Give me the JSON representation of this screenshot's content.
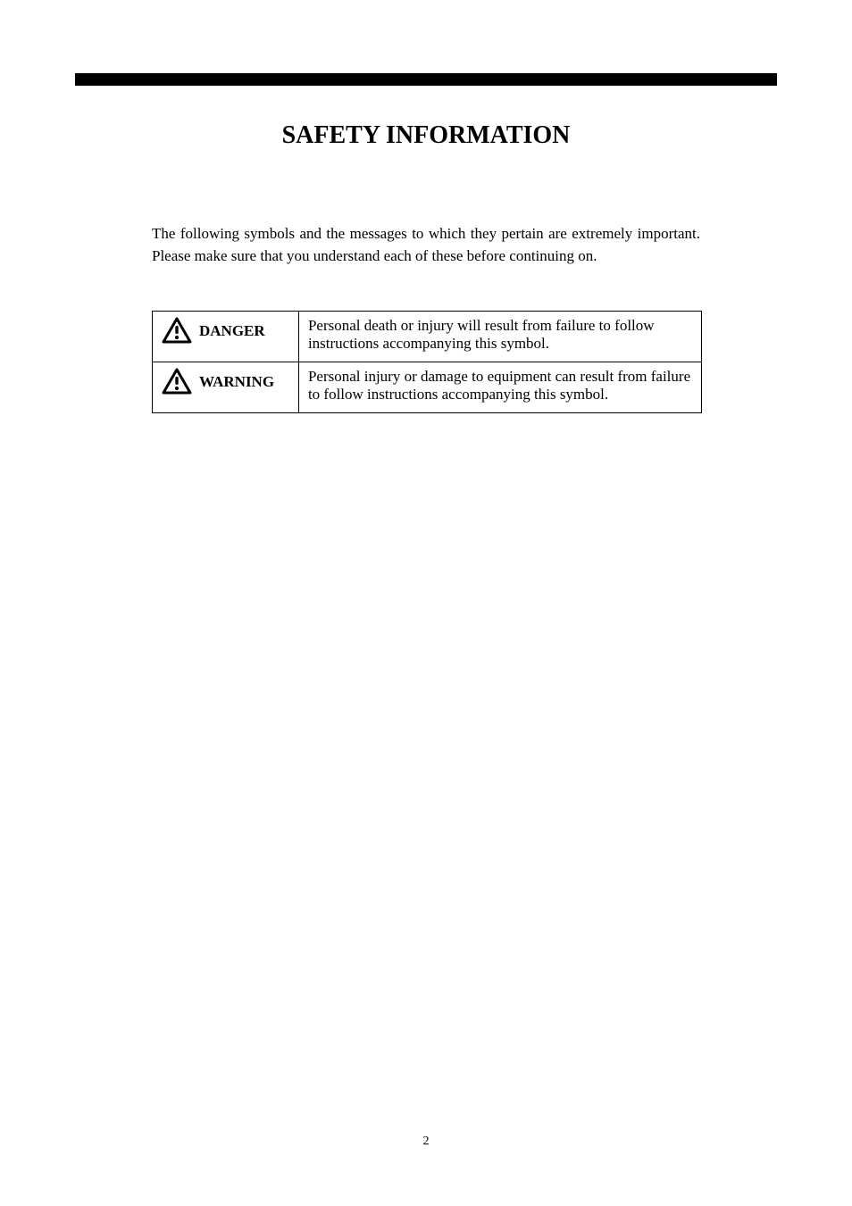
{
  "title": "SAFETY INFORMATION",
  "intro": "The following symbols and the messages to which they pertain are extremely important. Please make sure that you understand each of these before continuing on.",
  "rows": [
    {
      "label": "DANGER",
      "definition": "Personal death or injury will result from failure to follow instructions accompanying this symbol."
    },
    {
      "label": "WARNING",
      "definition": "Personal injury or damage to equipment can result from failure to follow instructions accompanying this symbol."
    }
  ],
  "footer": "2"
}
